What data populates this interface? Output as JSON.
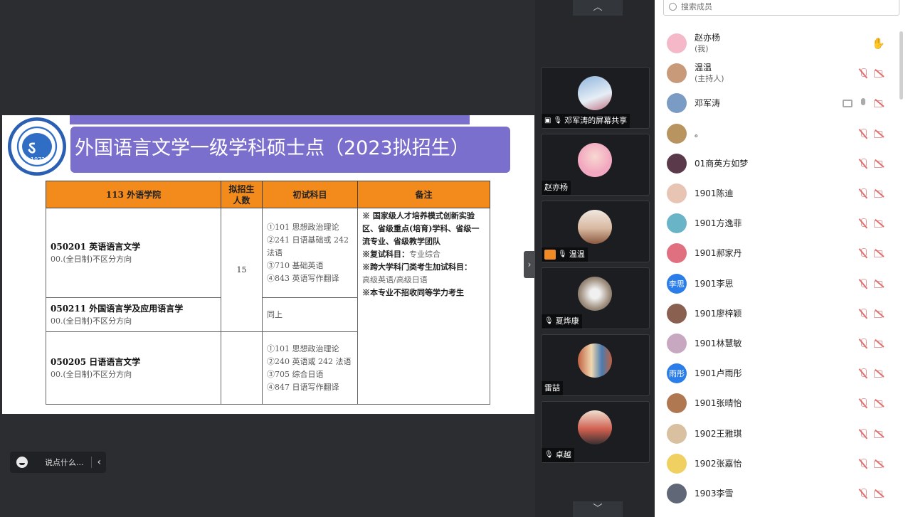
{
  "slide": {
    "logo_year": "1972",
    "title": "外国语言文学一级学科硕士点（2023拟招生）",
    "headers": [
      "113 外语学院",
      "拟招生人数",
      "初试科目",
      "备注"
    ],
    "rows": [
      {
        "code_name": "050201  英语语言文学",
        "direction": "00.(全日制)不区分方向",
        "quota": "15",
        "subjects": [
          "①101 思想政治理论",
          "②241 日语基础或 242 法语",
          "③710 基础英语",
          "④843 英语写作翻译"
        ]
      },
      {
        "code_name": "050211 外国语言学及应用语言学",
        "direction": "00.(全日制)不区分方向",
        "subjects_same": "同上"
      },
      {
        "code_name": "050205   日语语言文学",
        "direction": "00.(全日制)不区分方向",
        "subjects": [
          "①101 思想政治理论",
          "②240 英语或 242 法语",
          "③705 综合日语",
          "④847 日语写作翻译"
        ]
      }
    ],
    "notes": {
      "n1": "※ 国家级人才培养模式创新实验区、省级重点(培育)学科、省级一流专业、省级教学团队",
      "n2_label": "※复试科目：",
      "n2_value": "专业综合",
      "n3_label": "※跨大学科门类考生加试科目：",
      "n3_value": "高级英语/高级日语",
      "n4": "※本专业不招收同等学力考生"
    }
  },
  "chat": {
    "placeholder": "说点什么..."
  },
  "tiles": [
    {
      "name": "邓军涛的屏幕共享"
    },
    {
      "name": "赵亦杨"
    },
    {
      "name": "温温"
    },
    {
      "name": "夏烨康"
    },
    {
      "name": "雷喆"
    },
    {
      "name": "卓越"
    }
  ],
  "panel": {
    "search_placeholder": "搜索成员",
    "members": [
      {
        "name": "赵亦杨",
        "sub": "(我)",
        "status": "hand",
        "avatar_color": "#f4b8c8"
      },
      {
        "name": "温温",
        "sub": "(主持人)",
        "status": "muted",
        "avatar_color": "#c99a7a"
      },
      {
        "name": "邓军涛",
        "sub": "",
        "status": "sharing",
        "avatar_color": "#7a9cc4"
      },
      {
        "name": "。",
        "sub": "",
        "status": "muted",
        "avatar_color": "#b89560"
      },
      {
        "name": "01商英方如梦",
        "sub": "",
        "status": "muted",
        "avatar_color": "#5a3a4a"
      },
      {
        "name": "1901陈迪",
        "sub": "",
        "status": "muted",
        "avatar_color": "#e8c4b4"
      },
      {
        "name": "1901方逸菲",
        "sub": "",
        "status": "muted",
        "avatar_color": "#6ab4c8"
      },
      {
        "name": "1901郝家丹",
        "sub": "",
        "status": "muted",
        "avatar_color": "#e07080"
      },
      {
        "name": "1901李思",
        "sub": "",
        "status": "muted",
        "avatar_color": "#2b7de9",
        "avatar_text": "李思"
      },
      {
        "name": "1901廖梓颖",
        "sub": "",
        "status": "muted",
        "avatar_color": "#8a6050"
      },
      {
        "name": "1901林慧敏",
        "sub": "",
        "status": "muted",
        "avatar_color": "#c8a8c0"
      },
      {
        "name": "1901卢雨彤",
        "sub": "",
        "status": "muted",
        "avatar_color": "#2b7de9",
        "avatar_text": "雨彤"
      },
      {
        "name": "1901张晴怡",
        "sub": "",
        "status": "muted",
        "avatar_color": "#b07850"
      },
      {
        "name": "1902王雅琪",
        "sub": "",
        "status": "muted",
        "avatar_color": "#d8c0a0"
      },
      {
        "name": "1902张嘉怡",
        "sub": "",
        "status": "muted",
        "avatar_color": "#f0d060"
      },
      {
        "name": "1903李雪",
        "sub": "",
        "status": "muted",
        "avatar_color": "#606878"
      }
    ]
  }
}
